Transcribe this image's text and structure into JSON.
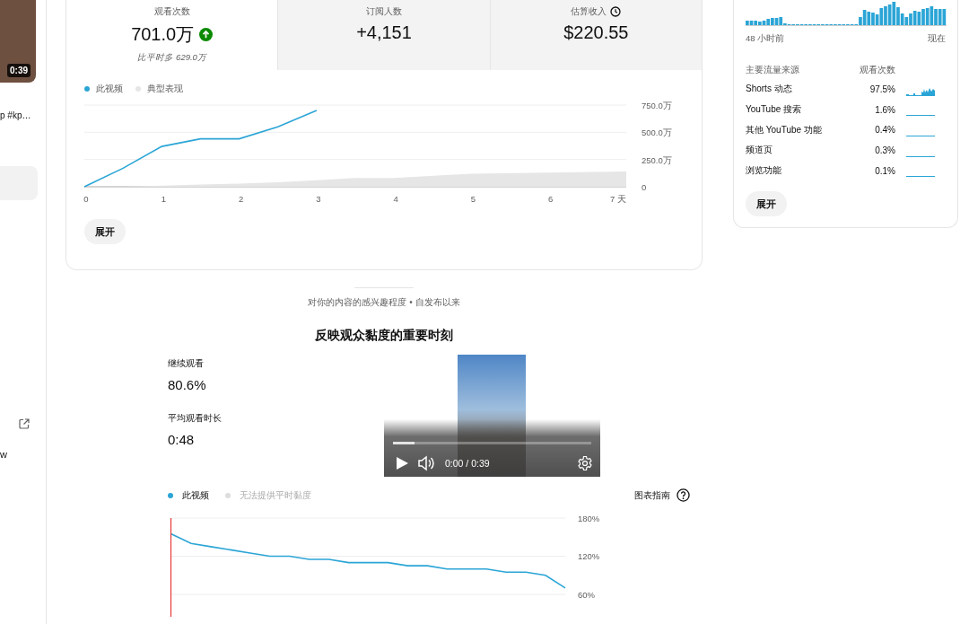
{
  "sidebar": {
    "thumbnail_duration": "0:39",
    "title_fragment": "p #kp…",
    "link_fragment": "w"
  },
  "overview": {
    "metrics": [
      {
        "label": "观看次数",
        "value": "701.0万",
        "kind": "trend-up",
        "note": "比平时多 629.0万",
        "selected": true
      },
      {
        "label": "订阅人数",
        "value": "+4,151",
        "kind": "plain",
        "selected": false
      },
      {
        "label": "估算收入",
        "value": "$220.55",
        "kind": "clock",
        "selected": false
      }
    ],
    "chart_data": {
      "type": "line",
      "x": [
        0,
        0.5,
        1,
        1.5,
        2,
        2.5,
        3,
        3.5,
        4,
        5,
        6,
        7
      ],
      "series": [
        {
          "name": "此视频",
          "type": "line",
          "color": "#2ba5d6",
          "values": [
            0,
            170,
            370,
            440,
            440,
            550,
            700,
            null,
            null,
            null,
            null,
            null
          ]
        },
        {
          "name": "典型表现",
          "type": "area",
          "color": "#e6e6e6",
          "values": [
            0,
            0,
            10,
            20,
            30,
            40,
            60,
            80,
            80,
            120,
            130,
            140
          ]
        }
      ],
      "xlim": [
        0,
        7
      ],
      "ylim": [
        0,
        750
      ],
      "grid": true,
      "xticks": [
        0,
        1,
        2,
        3,
        4,
        5,
        6,
        {
          "value": 7,
          "label": "7 天"
        }
      ],
      "yticks": [
        0,
        {
          "value": 250,
          "label": "250.0万"
        },
        {
          "value": 500,
          "label": "500.0万"
        },
        {
          "value": 750,
          "label": "750.0万"
        }
      ]
    },
    "expand_button": "展开"
  },
  "traffic": {
    "range_start": "48 小时前",
    "range_end": "现在",
    "header_source": "主要流量来源",
    "header_views": "观看次数",
    "rows": [
      {
        "source": "Shorts 动态",
        "share": "97.5%"
      },
      {
        "source": "YouTube 搜索",
        "share": "1.6%"
      },
      {
        "source": "其他 YouTube 功能",
        "share": "0.4%"
      },
      {
        "source": "频道页",
        "share": "0.3%"
      },
      {
        "source": "浏览功能",
        "share": "0.1%"
      }
    ],
    "expand_button": "展开"
  },
  "retention": {
    "subtitle": "对你的内容的感兴趣程度 • 自发布以来",
    "title": "反映观众黏度的重要时刻",
    "stats": [
      {
        "label": "继续观看",
        "value": "80.6%"
      },
      {
        "label": "平均观看时长",
        "value": "0:48"
      }
    ],
    "player": {
      "time": "0:00 / 0:39",
      "level": 0.11
    },
    "legend": [
      {
        "label": "无法提供平时黏度",
        "color": "#dddddd",
        "disabled": true
      }
    ],
    "guide_link": "图表指南",
    "chart_data": {
      "type": "line",
      "grid": true,
      "ylim": [
        60,
        180
      ],
      "series": [
        {
          "name": "此视频",
          "color": "#2ba5d6",
          "values": [
            155,
            140,
            135,
            130,
            125,
            120,
            120,
            115,
            115,
            110,
            110,
            110,
            105,
            105,
            100,
            100,
            100,
            95,
            95,
            90,
            70
          ]
        }
      ],
      "yticks": [
        {
          "value": 60,
          "label": "60%"
        },
        {
          "value": 120,
          "label": "120%"
        },
        {
          "value": 180,
          "label": "180%"
        }
      ]
    }
  }
}
